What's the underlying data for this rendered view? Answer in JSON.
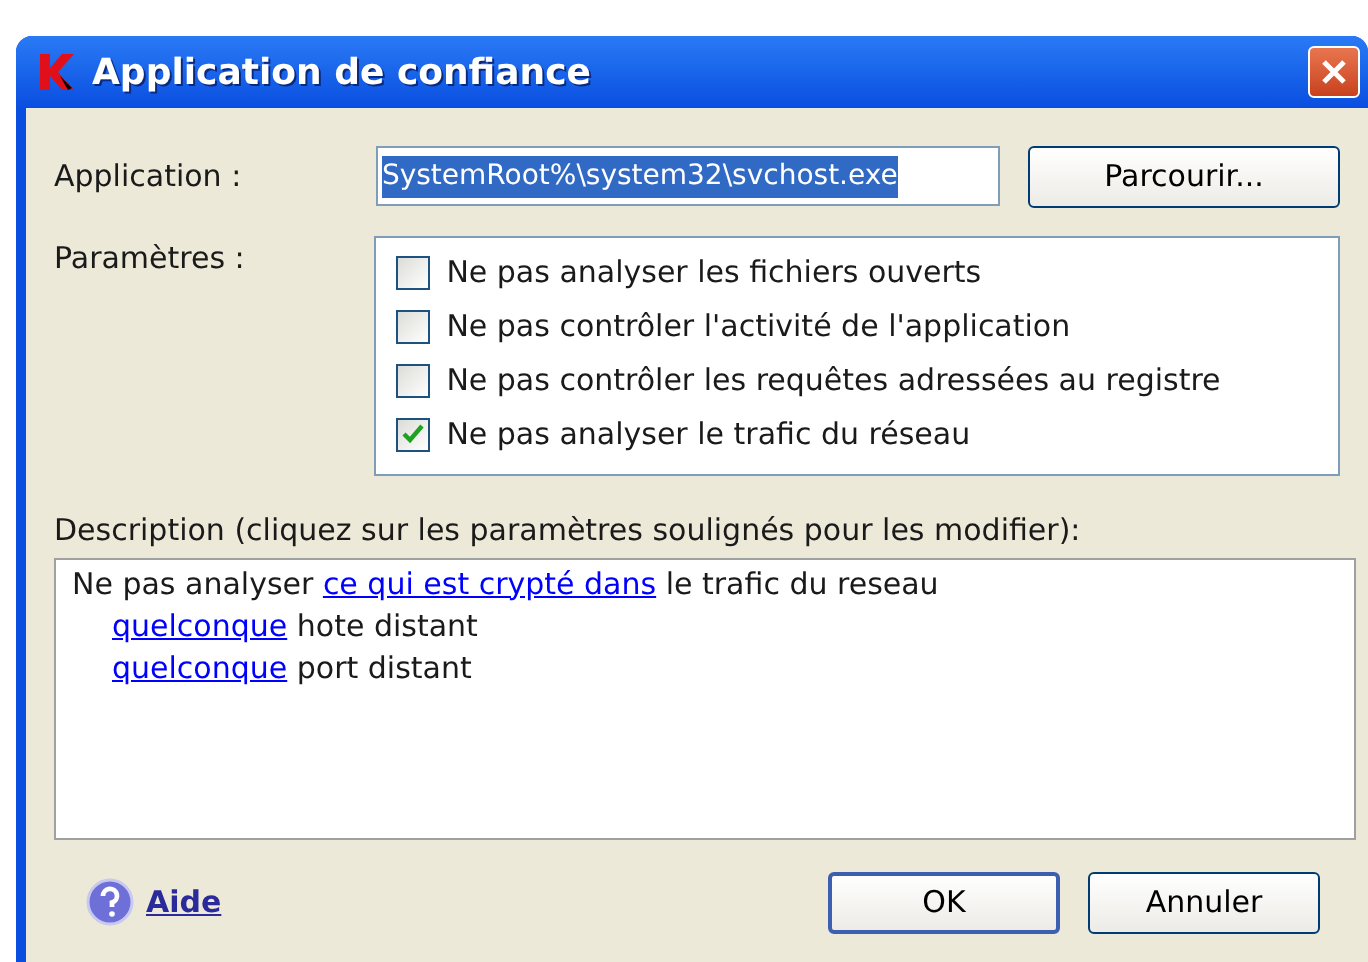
{
  "window": {
    "title": "Application de confiance"
  },
  "application": {
    "label": "Application :",
    "value": "SystemRoot%\\system32\\svchost.exe",
    "selected_text": true
  },
  "browse_button": "Parcourir...",
  "parameters": {
    "label": "Paramètres :",
    "options": [
      {
        "label": "Ne pas analyser les fichiers ouverts",
        "checked": false
      },
      {
        "label": "Ne pas contrôler l'activité de l'application",
        "checked": false
      },
      {
        "label": "Ne pas contrôler les requêtes adressées au registre",
        "checked": false
      },
      {
        "label": "Ne pas analyser le trafic du réseau",
        "checked": true
      }
    ]
  },
  "description": {
    "label": "Description (cliquez sur les paramètres soulignés pour les modifier):",
    "lines": [
      {
        "indented": false,
        "segments": [
          {
            "text": "Ne pas analyser ",
            "link": false
          },
          {
            "text": "ce qui est crypté dans",
            "link": true
          },
          {
            "text": " le trafic du reseau",
            "link": false
          }
        ]
      },
      {
        "indented": true,
        "segments": [
          {
            "text": "quelconque",
            "link": true
          },
          {
            "text": " hote distant",
            "link": false
          }
        ]
      },
      {
        "indented": true,
        "segments": [
          {
            "text": "quelconque",
            "link": true
          },
          {
            "text": " port distant",
            "link": false
          }
        ]
      }
    ]
  },
  "help_link": "Aide",
  "buttons": [
    {
      "label": "OK",
      "default": true
    },
    {
      "label": "Annuler",
      "default": false
    }
  ]
}
